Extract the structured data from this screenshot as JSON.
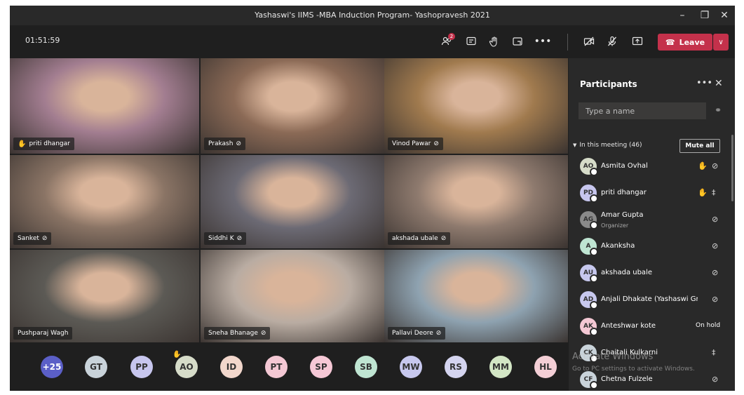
{
  "window": {
    "title": "Yashaswi's IIMS -MBA Induction Program- Yashopravesh 2021",
    "minimize_icon": "minimize-icon",
    "maximize_icon": "restore-icon",
    "close_icon": "close-icon"
  },
  "callbar": {
    "timer": "01:51:59",
    "participants_badge": "2",
    "leave_label": "Leave",
    "leave_color": "#c4314b"
  },
  "tiles": [
    {
      "name": "priti dhangar",
      "hand": true,
      "mic_off": false,
      "bg": "#a27d90"
    },
    {
      "name": "Prakash",
      "hand": false,
      "mic_off": true,
      "bg": "#8b6a56"
    },
    {
      "name": "Vinod Pawar",
      "hand": false,
      "mic_off": true,
      "bg": "#a07a4e"
    },
    {
      "name": "Sanket",
      "hand": false,
      "mic_off": true,
      "bg": "#8a7465"
    },
    {
      "name": "Siddhi K",
      "hand": false,
      "mic_off": true,
      "bg": "#6c6a74"
    },
    {
      "name": "akshada ubale",
      "hand": false,
      "mic_off": true,
      "bg": "#8e7a6e"
    },
    {
      "name": "Pushparaj Wagh",
      "hand": false,
      "mic_off": false,
      "bg": "#5c5a55"
    },
    {
      "name": "Sneha Bhanage",
      "hand": false,
      "mic_off": true,
      "bg": "#b9aca2"
    },
    {
      "name": "Pallavi Deore",
      "hand": false,
      "mic_off": true,
      "bg": "#8ea2b0"
    }
  ],
  "overflow_avatars": [
    {
      "initials": "+25",
      "color": "#5b5fc7"
    },
    {
      "initials": "GT",
      "color": "#c9d3da"
    },
    {
      "initials": "PP",
      "color": "#c7c6ee"
    },
    {
      "initials": "AO",
      "color": "#d6dcc9"
    },
    {
      "initials": "ID",
      "color": "#f2d7cc"
    },
    {
      "initials": "PT",
      "color": "#f4c8d4"
    },
    {
      "initials": "SP",
      "color": "#f6c8d6"
    },
    {
      "initials": "SB",
      "color": "#bfe5d2"
    },
    {
      "initials": "MW",
      "color": "#c7c8ee"
    },
    {
      "initials": "RS",
      "color": "#d4d4ef"
    },
    {
      "initials": "MM",
      "color": "#d3e6c5"
    },
    {
      "initials": "HL",
      "color": "#f4cfd6"
    }
  ],
  "panel": {
    "title": "Participants",
    "search_placeholder": "Type a name",
    "section_label": "In this meeting (46)",
    "mute_all_label": "Mute all",
    "participants": [
      {
        "initials": "AO",
        "name": "Asmita Ovhal",
        "role": "",
        "color": "#d6dcc9",
        "hand": true,
        "mic": "off",
        "status": ""
      },
      {
        "initials": "PD",
        "name": "priti dhangar",
        "role": "",
        "color": "#c7c6ee",
        "hand": true,
        "mic": "on",
        "status": ""
      },
      {
        "initials": "AG",
        "name": "Amar Gupta",
        "role": "Organizer",
        "color": "#8a8a8a",
        "hand": false,
        "mic": "off",
        "status": ""
      },
      {
        "initials": "A",
        "name": "Akanksha",
        "role": "",
        "color": "#bfe5d2",
        "hand": false,
        "mic": "off",
        "status": ""
      },
      {
        "initials": "AU",
        "name": "akshada ubale",
        "role": "",
        "color": "#c7c8ee",
        "hand": false,
        "mic": "off",
        "status": ""
      },
      {
        "initials": "AD",
        "name": "Anjali Dhakate (Yashaswi Gro...",
        "role": "",
        "color": "#c7c8ee",
        "hand": false,
        "mic": "off",
        "status": ""
      },
      {
        "initials": "AK",
        "name": "Anteshwar kote",
        "role": "",
        "color": "#f4c8d4",
        "hand": false,
        "mic": "",
        "status": "On hold"
      },
      {
        "initials": "CK",
        "name": "Chaitali Kulkarni",
        "role": "",
        "color": "#c9d3da",
        "hand": false,
        "mic": "on",
        "status": ""
      },
      {
        "initials": "CF",
        "name": "Chetna Fulzele",
        "role": "",
        "color": "#c9d3da",
        "hand": false,
        "mic": "off",
        "status": ""
      }
    ]
  },
  "watermark": {
    "line1": "Activate Windows",
    "line2": "Go to PC settings to activate Windows."
  }
}
